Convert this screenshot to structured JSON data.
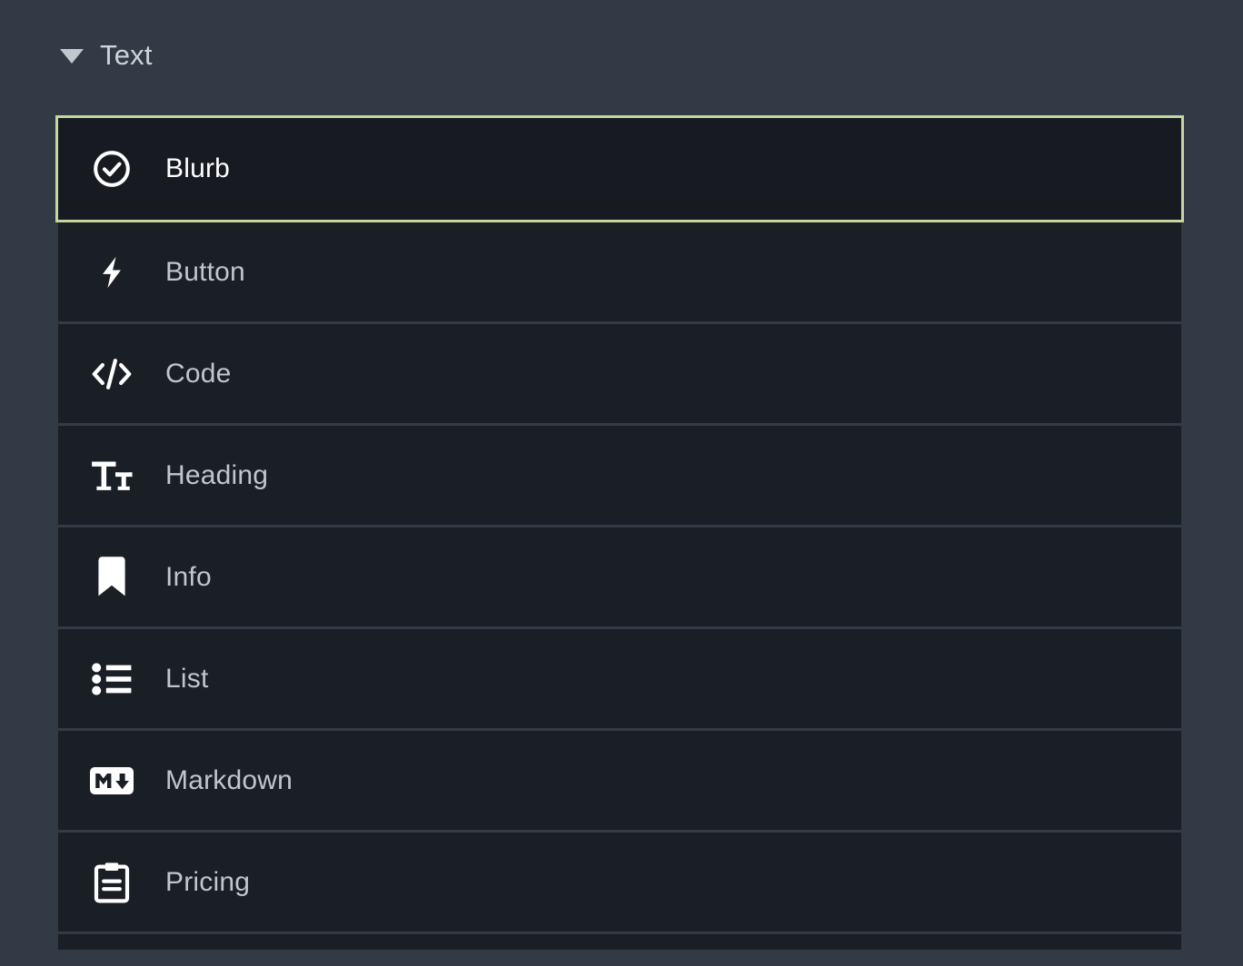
{
  "theme": {
    "background": "#323a46",
    "row_background": "#1a1e25",
    "row_separator": "#333b47",
    "selected_border": "#c6d69e",
    "selected_background": "#171b21",
    "label_color": "#c1c6cd",
    "selected_label_color": "#ffffff",
    "icon_color": "#ffffff"
  },
  "section": {
    "title": "Text",
    "expanded": true,
    "disclosure_icon": "triangle-down-icon"
  },
  "items": [
    {
      "label": "Blurb",
      "icon": "check-circle-icon",
      "selected": true
    },
    {
      "label": "Button",
      "icon": "lightning-bolt-icon",
      "selected": false
    },
    {
      "label": "Code",
      "icon": "code-brackets-icon",
      "selected": false
    },
    {
      "label": "Heading",
      "icon": "text-size-icon",
      "selected": false
    },
    {
      "label": "Info",
      "icon": "bookmark-icon",
      "selected": false
    },
    {
      "label": "List",
      "icon": "bulleted-list-icon",
      "selected": false
    },
    {
      "label": "Markdown",
      "icon": "markdown-icon",
      "selected": false
    },
    {
      "label": "Pricing",
      "icon": "clipboard-icon",
      "selected": false
    },
    {
      "label": "",
      "icon": "",
      "selected": false
    }
  ]
}
